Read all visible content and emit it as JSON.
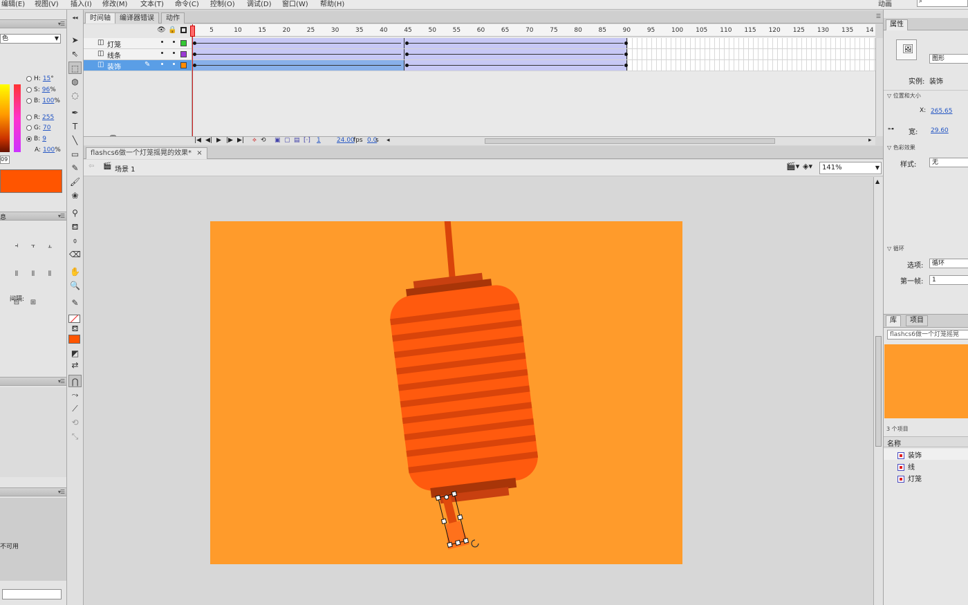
{
  "menu": [
    "编辑(E)",
    "视图(V)",
    "插入(I)",
    "修改(M)",
    "文本(T)",
    "命令(C)",
    "控制(O)",
    "调试(D)",
    "窗口(W)",
    "帮助(H)"
  ],
  "workspace": "动画",
  "color_panel": {
    "type_value": "色",
    "h": "15",
    "s": "96",
    "b": "100",
    "r": "255",
    "g": "70",
    "b2": "9",
    "alpha": "100",
    "hex_value": "09",
    "h_unit": "°",
    "pct": "%",
    "swatch_color": "#ff5500"
  },
  "align_panel": {
    "header": "息",
    "spacing_label": "间隔:"
  },
  "unavailable_text": "不可用",
  "timeline": {
    "tabs": [
      "时间轴",
      "编译器错误",
      "动作"
    ],
    "layers": [
      {
        "name": "灯笼",
        "color": "#34c834"
      },
      {
        "name": "线条",
        "color": "#9b3ad6"
      },
      {
        "name": "装饰",
        "color": "#ff8c00"
      }
    ],
    "ruler_labels": [
      "1",
      "5",
      "10",
      "15",
      "20",
      "25",
      "30",
      "35",
      "40",
      "45",
      "50",
      "55",
      "60",
      "65",
      "70",
      "75",
      "80",
      "85",
      "90",
      "95",
      "100",
      "105",
      "110",
      "115",
      "120",
      "125",
      "130",
      "135",
      "14"
    ],
    "current_frame": "1",
    "fps": "24.00",
    "fps_unit": "fps",
    "elapsed": "0.0",
    "elapsed_unit": "s"
  },
  "document": {
    "tab_title": "flashcs6做一个灯笼摇晃的效果*",
    "tab_close": "×",
    "scene": "场景 1",
    "zoom": "141%"
  },
  "properties": {
    "tabs": [
      "属性"
    ],
    "symbol_type": "图形",
    "instance_label": "实例:",
    "instance_value": "装饰",
    "section_position": "位置和大小",
    "x_label": "X:",
    "x_value": "265.65",
    "width_label": "宽:",
    "width_value": "29.60",
    "section_color": "色彩效果",
    "style_label": "样式:",
    "style_value": "无",
    "section_loop": "循环",
    "option_label": "选项:",
    "option_value": "循环",
    "first_frame_label": "第一帧:",
    "first_frame_value": "1"
  },
  "library": {
    "tabs": [
      "库",
      "项目"
    ],
    "doc_select": "flashcs6做一个灯笼摇晃",
    "count": "3 个项目",
    "name_header": "名称",
    "items": [
      "装饰",
      "线",
      "灯笼"
    ]
  },
  "colors": {
    "stage": "#ff9b2b",
    "lantern_body": "#ff5a0e",
    "lantern_stripe": "#d9440a",
    "cap": "#c84010",
    "cap_dark": "#a83508",
    "tassel": "#ff5a0e",
    "selected_layer": "#5a9ee6"
  }
}
